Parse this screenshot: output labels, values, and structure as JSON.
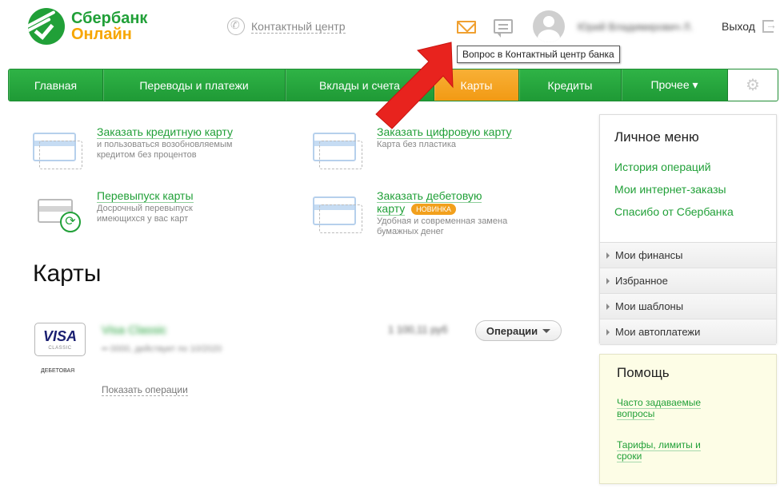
{
  "header": {
    "logo_line1": "Сбербанк",
    "logo_line2": "Онлайн",
    "contact_center": "Контактный центр",
    "tooltip": "Вопрос в Контактный центр банка",
    "user_name": "Юрий Владимирович Л.",
    "logout": "Выход"
  },
  "nav": {
    "items": [
      {
        "label": "Главная"
      },
      {
        "label": "Переводы и платежи"
      },
      {
        "label": "Вклады и счета"
      },
      {
        "label": "Карты"
      },
      {
        "label": "Кредиты"
      },
      {
        "label": "Прочее ▾"
      }
    ],
    "active": "Карты"
  },
  "quick_actions": [
    {
      "title": "Заказать кредитную карту",
      "desc": "и пользоваться возобновляемым кредитом без процентов"
    },
    {
      "title": "Заказать цифровую карту",
      "desc": "Карта без пластика"
    },
    {
      "title": "Перевыпуск карты",
      "desc": "Досрочный перевыпуск имеющихся у вас карт"
    },
    {
      "title": "Заказать дебетовую карту",
      "badge": "НОВИНКА",
      "desc": "Удобная и современная замена бумажных денег"
    }
  ],
  "page_title": "Карты",
  "card": {
    "brand": "VISA",
    "brand_sub": "CLASSIC",
    "type_caption": "ДЕБЕТОВАЯ",
    "name": "Visa Classic",
    "number": "•• 0000, действует по 10/2020",
    "balance": "1 100,11 руб",
    "operations_button": "Операции",
    "show_operations": "Показать операции"
  },
  "personal_menu": {
    "title": "Личное меню",
    "links": [
      "История операций",
      "Мои интернет-заказы",
      "Спасибо от Сбербанка"
    ],
    "sections": [
      "Мои финансы",
      "Избранное",
      "Мои шаблоны",
      "Мои автоплатежи"
    ]
  },
  "help": {
    "title": "Помощь",
    "links": [
      "Часто задаваемые вопросы",
      "Тарифы, лимиты и сроки"
    ]
  },
  "colors": {
    "brand_green": "#21a038",
    "brand_orange": "#f7a600",
    "nav_active": "#f29a14",
    "annotation_arrow": "#e8231e"
  },
  "icons": [
    "sberbank-logo-icon",
    "phone-icon",
    "mail-icon",
    "chat-icon",
    "avatar-icon",
    "logout-icon",
    "settings-gear-icon",
    "credit-card-icon",
    "card-renew-icon",
    "chevron-right-icon",
    "chevron-down-icon"
  ]
}
